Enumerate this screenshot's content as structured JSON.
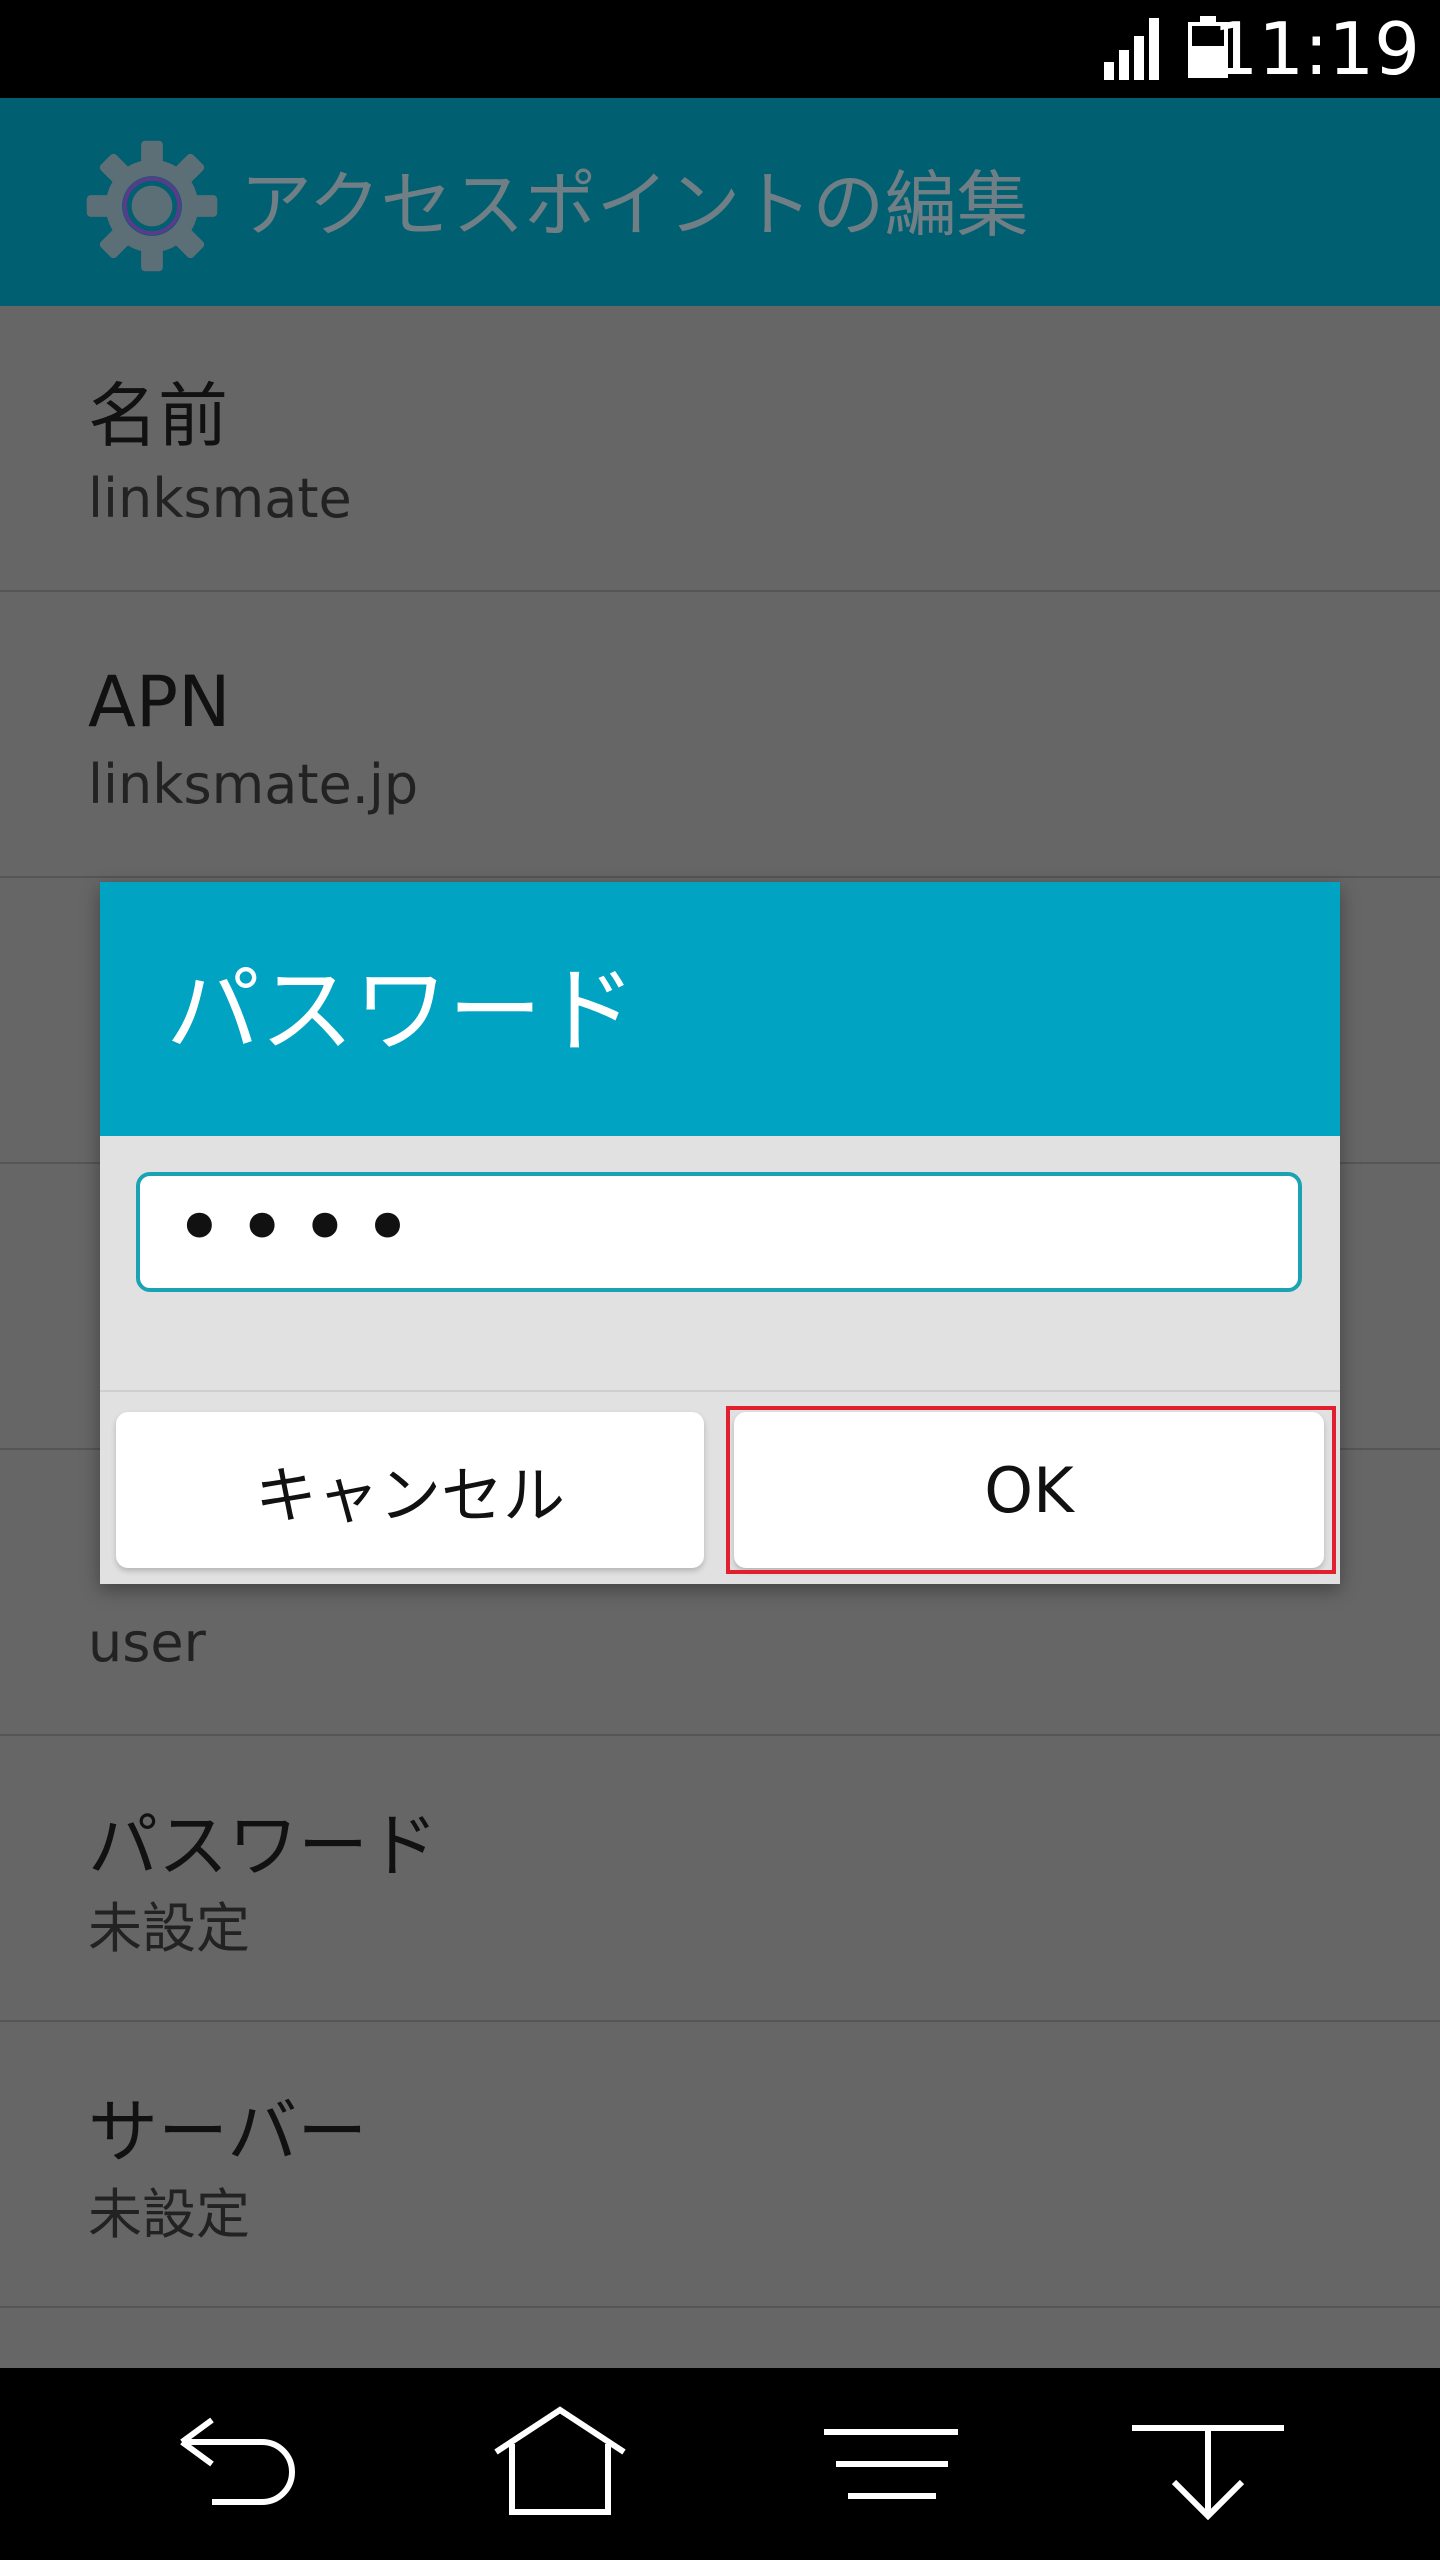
{
  "status_bar": {
    "time": "11:19",
    "icons": [
      "signal-icon",
      "battery-icon"
    ]
  },
  "action_bar": {
    "icon": "settings-gear-icon",
    "title": "アクセスポイントの編集"
  },
  "settings_list": [
    {
      "title": "名前",
      "value": "linksmate"
    },
    {
      "title": "APN",
      "value": "linksmate.jp"
    },
    {
      "title": "",
      "value": ""
    },
    {
      "title": "",
      "value": ""
    },
    {
      "title": "",
      "value": "user"
    },
    {
      "title": "パスワード",
      "value": "未設定"
    },
    {
      "title": "サーバー",
      "value": "未設定"
    }
  ],
  "dialog": {
    "title": "パスワード",
    "input_value": "••••",
    "cancel_label": "キャンセル",
    "ok_label": "OK"
  },
  "nav_bar": {
    "buttons": [
      "back-icon",
      "home-icon",
      "menu-icon",
      "notification-pulldown-icon"
    ]
  },
  "colors": {
    "action_bar": "#005f70",
    "dialog_header": "#00a3c1",
    "highlight": "#e0202e",
    "dim_background": "#666666"
  }
}
